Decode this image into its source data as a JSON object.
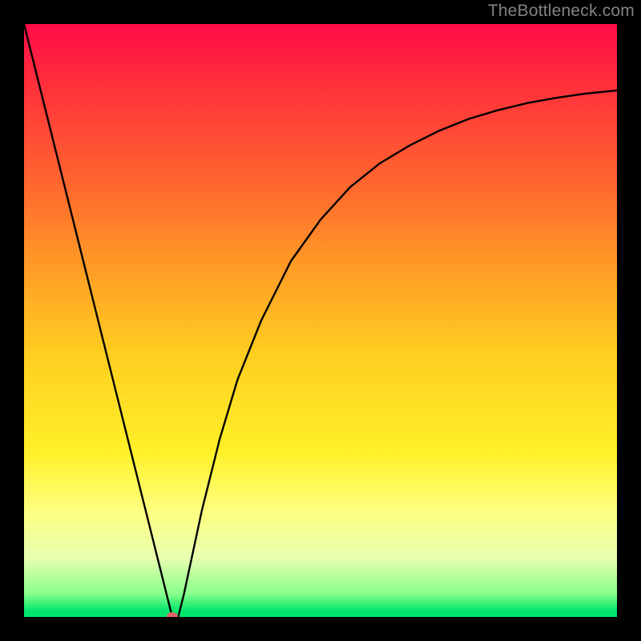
{
  "watermark": "TheBottleneck.com",
  "chart_data": {
    "type": "line",
    "title": "",
    "xlabel": "",
    "ylabel": "",
    "xlim": [
      0,
      100
    ],
    "ylim": [
      0,
      100
    ],
    "series": [
      {
        "name": "curve",
        "x": [
          0,
          3,
          6,
          9,
          12,
          15,
          18,
          21,
          23,
          25,
          26,
          27,
          30,
          33,
          36,
          40,
          45,
          50,
          55,
          60,
          65,
          70,
          75,
          80,
          85,
          90,
          95,
          100
        ],
        "y": [
          100,
          88,
          76,
          64,
          52,
          40,
          28,
          16,
          8,
          0,
          0,
          4,
          18,
          30,
          40,
          50,
          60,
          67,
          72.5,
          76.5,
          79.5,
          82,
          84,
          85.5,
          86.7,
          87.6,
          88.3,
          88.8
        ]
      }
    ],
    "marker": {
      "x": 25,
      "y": 0,
      "color": "#e06666"
    },
    "gradient_stops": [
      {
        "pos": 0,
        "color": "#ff0b49"
      },
      {
        "pos": 10,
        "color": "#ff2f3b"
      },
      {
        "pos": 28,
        "color": "#ff6a2e"
      },
      {
        "pos": 42,
        "color": "#ff9f25"
      },
      {
        "pos": 56,
        "color": "#ffcf20"
      },
      {
        "pos": 72,
        "color": "#fff028"
      },
      {
        "pos": 82,
        "color": "#feff7e"
      },
      {
        "pos": 90,
        "color": "#e8ffb0"
      },
      {
        "pos": 96,
        "color": "#8aff8c"
      },
      {
        "pos": 100,
        "color": "#00e66a"
      }
    ]
  }
}
